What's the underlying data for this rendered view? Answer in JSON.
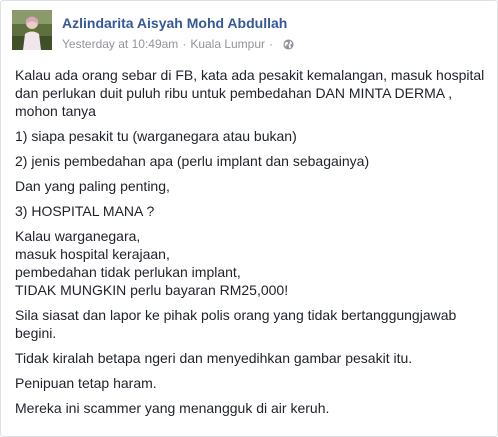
{
  "post": {
    "author": "Azlindarita Aisyah Mohd Abdullah",
    "timestamp": "Yesterday at 10:49am",
    "separator": "·",
    "location": "Kuala Lumpur",
    "privacy_icon": "globe-icon",
    "avatar_icon": "profile-photo",
    "paragraphs": [
      [
        "Kalau ada orang sebar di FB, kata ada pesakit kemalangan, masuk hospital dan perlukan duit puluh ribu untuk pembedahan DAN MINTA DERMA , mohon tanya"
      ],
      [
        "1) siapa pesakit tu (warganegara atau bukan)"
      ],
      [
        "2) jenis pembedahan apa (perlu implant dan sebagainya)"
      ],
      [
        "Dan yang paling penting,"
      ],
      [
        "3) HOSPITAL MANA ?"
      ],
      [
        "Kalau warganegara,",
        "masuk hospital kerajaan,",
        "pembedahan tidak perlukan implant,",
        "TIDAK MUNGKIN perlu bayaran RM25,000!"
      ],
      [
        "Sila siasat dan lapor ke pihak polis orang yang tidak bertanggungjawab begini."
      ],
      [
        "Tidak kiralah betapa ngeri dan menyedihkan gambar pesakit itu."
      ],
      [
        "Penipuan tetap haram."
      ],
      [
        "Mereka ini scammer yang menangguk di air keruh."
      ]
    ]
  },
  "colors": {
    "author": "#365899",
    "meta": "#90949c",
    "text": "#1d2129",
    "border": "#dddfe2"
  }
}
